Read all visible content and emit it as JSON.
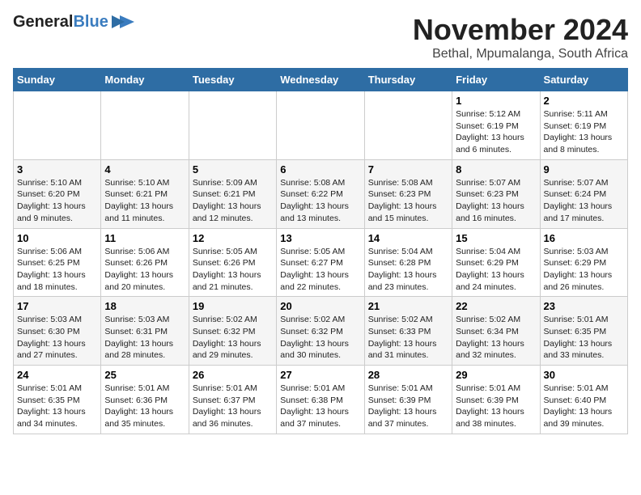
{
  "logo": {
    "line1": "General",
    "line2": "Blue"
  },
  "title": "November 2024",
  "location": "Bethal, Mpumalanga, South Africa",
  "weekdays": [
    "Sunday",
    "Monday",
    "Tuesday",
    "Wednesday",
    "Thursday",
    "Friday",
    "Saturday"
  ],
  "weeks": [
    [
      {
        "day": "",
        "detail": ""
      },
      {
        "day": "",
        "detail": ""
      },
      {
        "day": "",
        "detail": ""
      },
      {
        "day": "",
        "detail": ""
      },
      {
        "day": "",
        "detail": ""
      },
      {
        "day": "1",
        "detail": "Sunrise: 5:12 AM\nSunset: 6:19 PM\nDaylight: 13 hours\nand 6 minutes."
      },
      {
        "day": "2",
        "detail": "Sunrise: 5:11 AM\nSunset: 6:19 PM\nDaylight: 13 hours\nand 8 minutes."
      }
    ],
    [
      {
        "day": "3",
        "detail": "Sunrise: 5:10 AM\nSunset: 6:20 PM\nDaylight: 13 hours\nand 9 minutes."
      },
      {
        "day": "4",
        "detail": "Sunrise: 5:10 AM\nSunset: 6:21 PM\nDaylight: 13 hours\nand 11 minutes."
      },
      {
        "day": "5",
        "detail": "Sunrise: 5:09 AM\nSunset: 6:21 PM\nDaylight: 13 hours\nand 12 minutes."
      },
      {
        "day": "6",
        "detail": "Sunrise: 5:08 AM\nSunset: 6:22 PM\nDaylight: 13 hours\nand 13 minutes."
      },
      {
        "day": "7",
        "detail": "Sunrise: 5:08 AM\nSunset: 6:23 PM\nDaylight: 13 hours\nand 15 minutes."
      },
      {
        "day": "8",
        "detail": "Sunrise: 5:07 AM\nSunset: 6:23 PM\nDaylight: 13 hours\nand 16 minutes."
      },
      {
        "day": "9",
        "detail": "Sunrise: 5:07 AM\nSunset: 6:24 PM\nDaylight: 13 hours\nand 17 minutes."
      }
    ],
    [
      {
        "day": "10",
        "detail": "Sunrise: 5:06 AM\nSunset: 6:25 PM\nDaylight: 13 hours\nand 18 minutes."
      },
      {
        "day": "11",
        "detail": "Sunrise: 5:06 AM\nSunset: 6:26 PM\nDaylight: 13 hours\nand 20 minutes."
      },
      {
        "day": "12",
        "detail": "Sunrise: 5:05 AM\nSunset: 6:26 PM\nDaylight: 13 hours\nand 21 minutes."
      },
      {
        "day": "13",
        "detail": "Sunrise: 5:05 AM\nSunset: 6:27 PM\nDaylight: 13 hours\nand 22 minutes."
      },
      {
        "day": "14",
        "detail": "Sunrise: 5:04 AM\nSunset: 6:28 PM\nDaylight: 13 hours\nand 23 minutes."
      },
      {
        "day": "15",
        "detail": "Sunrise: 5:04 AM\nSunset: 6:29 PM\nDaylight: 13 hours\nand 24 minutes."
      },
      {
        "day": "16",
        "detail": "Sunrise: 5:03 AM\nSunset: 6:29 PM\nDaylight: 13 hours\nand 26 minutes."
      }
    ],
    [
      {
        "day": "17",
        "detail": "Sunrise: 5:03 AM\nSunset: 6:30 PM\nDaylight: 13 hours\nand 27 minutes."
      },
      {
        "day": "18",
        "detail": "Sunrise: 5:03 AM\nSunset: 6:31 PM\nDaylight: 13 hours\nand 28 minutes."
      },
      {
        "day": "19",
        "detail": "Sunrise: 5:02 AM\nSunset: 6:32 PM\nDaylight: 13 hours\nand 29 minutes."
      },
      {
        "day": "20",
        "detail": "Sunrise: 5:02 AM\nSunset: 6:32 PM\nDaylight: 13 hours\nand 30 minutes."
      },
      {
        "day": "21",
        "detail": "Sunrise: 5:02 AM\nSunset: 6:33 PM\nDaylight: 13 hours\nand 31 minutes."
      },
      {
        "day": "22",
        "detail": "Sunrise: 5:02 AM\nSunset: 6:34 PM\nDaylight: 13 hours\nand 32 minutes."
      },
      {
        "day": "23",
        "detail": "Sunrise: 5:01 AM\nSunset: 6:35 PM\nDaylight: 13 hours\nand 33 minutes."
      }
    ],
    [
      {
        "day": "24",
        "detail": "Sunrise: 5:01 AM\nSunset: 6:35 PM\nDaylight: 13 hours\nand 34 minutes."
      },
      {
        "day": "25",
        "detail": "Sunrise: 5:01 AM\nSunset: 6:36 PM\nDaylight: 13 hours\nand 35 minutes."
      },
      {
        "day": "26",
        "detail": "Sunrise: 5:01 AM\nSunset: 6:37 PM\nDaylight: 13 hours\nand 36 minutes."
      },
      {
        "day": "27",
        "detail": "Sunrise: 5:01 AM\nSunset: 6:38 PM\nDaylight: 13 hours\nand 37 minutes."
      },
      {
        "day": "28",
        "detail": "Sunrise: 5:01 AM\nSunset: 6:39 PM\nDaylight: 13 hours\nand 37 minutes."
      },
      {
        "day": "29",
        "detail": "Sunrise: 5:01 AM\nSunset: 6:39 PM\nDaylight: 13 hours\nand 38 minutes."
      },
      {
        "day": "30",
        "detail": "Sunrise: 5:01 AM\nSunset: 6:40 PM\nDaylight: 13 hours\nand 39 minutes."
      }
    ]
  ]
}
